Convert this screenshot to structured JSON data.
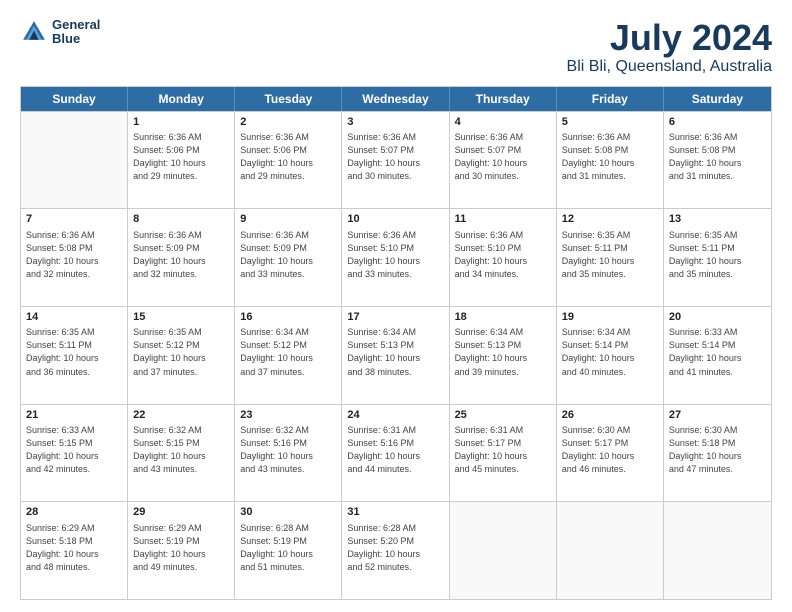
{
  "header": {
    "logo_line1": "General",
    "logo_line2": "Blue",
    "title": "July 2024",
    "subtitle": "Bli Bli, Queensland, Australia"
  },
  "days_of_week": [
    "Sunday",
    "Monday",
    "Tuesday",
    "Wednesday",
    "Thursday",
    "Friday",
    "Saturday"
  ],
  "weeks": [
    [
      {
        "day": "",
        "info": ""
      },
      {
        "day": "1",
        "info": "Sunrise: 6:36 AM\nSunset: 5:06 PM\nDaylight: 10 hours\nand 29 minutes."
      },
      {
        "day": "2",
        "info": "Sunrise: 6:36 AM\nSunset: 5:06 PM\nDaylight: 10 hours\nand 29 minutes."
      },
      {
        "day": "3",
        "info": "Sunrise: 6:36 AM\nSunset: 5:07 PM\nDaylight: 10 hours\nand 30 minutes."
      },
      {
        "day": "4",
        "info": "Sunrise: 6:36 AM\nSunset: 5:07 PM\nDaylight: 10 hours\nand 30 minutes."
      },
      {
        "day": "5",
        "info": "Sunrise: 6:36 AM\nSunset: 5:08 PM\nDaylight: 10 hours\nand 31 minutes."
      },
      {
        "day": "6",
        "info": "Sunrise: 6:36 AM\nSunset: 5:08 PM\nDaylight: 10 hours\nand 31 minutes."
      }
    ],
    [
      {
        "day": "7",
        "info": "Sunrise: 6:36 AM\nSunset: 5:08 PM\nDaylight: 10 hours\nand 32 minutes."
      },
      {
        "day": "8",
        "info": "Sunrise: 6:36 AM\nSunset: 5:09 PM\nDaylight: 10 hours\nand 32 minutes."
      },
      {
        "day": "9",
        "info": "Sunrise: 6:36 AM\nSunset: 5:09 PM\nDaylight: 10 hours\nand 33 minutes."
      },
      {
        "day": "10",
        "info": "Sunrise: 6:36 AM\nSunset: 5:10 PM\nDaylight: 10 hours\nand 33 minutes."
      },
      {
        "day": "11",
        "info": "Sunrise: 6:36 AM\nSunset: 5:10 PM\nDaylight: 10 hours\nand 34 minutes."
      },
      {
        "day": "12",
        "info": "Sunrise: 6:35 AM\nSunset: 5:11 PM\nDaylight: 10 hours\nand 35 minutes."
      },
      {
        "day": "13",
        "info": "Sunrise: 6:35 AM\nSunset: 5:11 PM\nDaylight: 10 hours\nand 35 minutes."
      }
    ],
    [
      {
        "day": "14",
        "info": "Sunrise: 6:35 AM\nSunset: 5:11 PM\nDaylight: 10 hours\nand 36 minutes."
      },
      {
        "day": "15",
        "info": "Sunrise: 6:35 AM\nSunset: 5:12 PM\nDaylight: 10 hours\nand 37 minutes."
      },
      {
        "day": "16",
        "info": "Sunrise: 6:34 AM\nSunset: 5:12 PM\nDaylight: 10 hours\nand 37 minutes."
      },
      {
        "day": "17",
        "info": "Sunrise: 6:34 AM\nSunset: 5:13 PM\nDaylight: 10 hours\nand 38 minutes."
      },
      {
        "day": "18",
        "info": "Sunrise: 6:34 AM\nSunset: 5:13 PM\nDaylight: 10 hours\nand 39 minutes."
      },
      {
        "day": "19",
        "info": "Sunrise: 6:34 AM\nSunset: 5:14 PM\nDaylight: 10 hours\nand 40 minutes."
      },
      {
        "day": "20",
        "info": "Sunrise: 6:33 AM\nSunset: 5:14 PM\nDaylight: 10 hours\nand 41 minutes."
      }
    ],
    [
      {
        "day": "21",
        "info": "Sunrise: 6:33 AM\nSunset: 5:15 PM\nDaylight: 10 hours\nand 42 minutes."
      },
      {
        "day": "22",
        "info": "Sunrise: 6:32 AM\nSunset: 5:15 PM\nDaylight: 10 hours\nand 43 minutes."
      },
      {
        "day": "23",
        "info": "Sunrise: 6:32 AM\nSunset: 5:16 PM\nDaylight: 10 hours\nand 43 minutes."
      },
      {
        "day": "24",
        "info": "Sunrise: 6:31 AM\nSunset: 5:16 PM\nDaylight: 10 hours\nand 44 minutes."
      },
      {
        "day": "25",
        "info": "Sunrise: 6:31 AM\nSunset: 5:17 PM\nDaylight: 10 hours\nand 45 minutes."
      },
      {
        "day": "26",
        "info": "Sunrise: 6:30 AM\nSunset: 5:17 PM\nDaylight: 10 hours\nand 46 minutes."
      },
      {
        "day": "27",
        "info": "Sunrise: 6:30 AM\nSunset: 5:18 PM\nDaylight: 10 hours\nand 47 minutes."
      }
    ],
    [
      {
        "day": "28",
        "info": "Sunrise: 6:29 AM\nSunset: 5:18 PM\nDaylight: 10 hours\nand 48 minutes."
      },
      {
        "day": "29",
        "info": "Sunrise: 6:29 AM\nSunset: 5:19 PM\nDaylight: 10 hours\nand 49 minutes."
      },
      {
        "day": "30",
        "info": "Sunrise: 6:28 AM\nSunset: 5:19 PM\nDaylight: 10 hours\nand 51 minutes."
      },
      {
        "day": "31",
        "info": "Sunrise: 6:28 AM\nSunset: 5:20 PM\nDaylight: 10 hours\nand 52 minutes."
      },
      {
        "day": "",
        "info": ""
      },
      {
        "day": "",
        "info": ""
      },
      {
        "day": "",
        "info": ""
      }
    ]
  ]
}
